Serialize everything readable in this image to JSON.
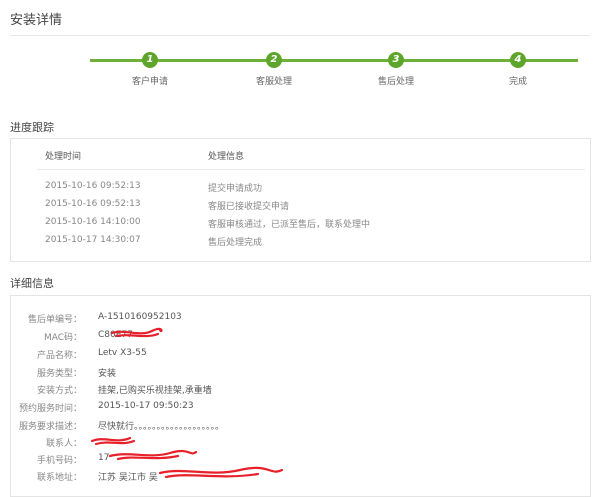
{
  "page": {
    "title": "安装详情"
  },
  "steps": [
    {
      "number": "1",
      "label": "客户申请"
    },
    {
      "number": "2",
      "label": "客服处理"
    },
    {
      "number": "3",
      "label": "售后处理"
    },
    {
      "number": "4",
      "label": "完成"
    }
  ],
  "current_step": 4,
  "tracking": {
    "title": "进度跟踪",
    "col_time": "处理时间",
    "col_info": "处理信息",
    "rows": [
      {
        "time": "2015-10-16 09:52:13",
        "info": "提交申请成功"
      },
      {
        "time": "2015-10-16 09:52:13",
        "info": "客服已接收提交申请"
      },
      {
        "time": "2015-10-16 14:10:00",
        "info": "客服审核通过，已派至售后，联系处理中"
      },
      {
        "time": "2015-10-17 14:30:07",
        "info": "售后处理完成"
      }
    ]
  },
  "details": {
    "title": "详细信息",
    "rows": [
      {
        "label": "售后单编号：",
        "value": "A-1510160952103"
      },
      {
        "label": "MAC码：",
        "value": "C80E77"
      },
      {
        "label": "产品名称：",
        "value": "Letv X3-55"
      },
      {
        "label": "服务类型：",
        "value": "安装"
      },
      {
        "label": "安装方式：",
        "value": "挂架,已购买乐视挂架,承重墙"
      },
      {
        "label": "预约服务时间：",
        "value": "2015-10-17 09:50:23"
      },
      {
        "label": "服务要求描述：",
        "value": "尽快就行。。。。。。。。。。。。。。。。。。。"
      },
      {
        "label": "联系人：",
        "value": ""
      },
      {
        "label": "手机号码：",
        "value": "17"
      },
      {
        "label": "联系地址：",
        "value": "江苏 吴江市 吴"
      }
    ]
  },
  "colors": {
    "step_active": "#5ea52c",
    "step_inactive": "#c6e3a8",
    "redaction": "#e8202a"
  }
}
